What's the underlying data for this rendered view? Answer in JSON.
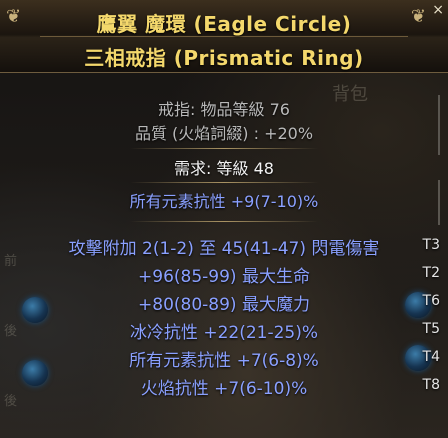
{
  "item": {
    "name_line1": "鷹翼 魔環 (Eagle Circle)",
    "name_line2": "三相戒指 (Prismatic Ring)",
    "category_label": "戒指: 物品等級 76",
    "quality_label": "品質 (火焰詞綴) : +20%",
    "requirements_label": "需求: 等級 48",
    "implicit_mod": "所有元素抗性 +9(7-10)%",
    "explicit_mods": [
      {
        "text": "攻擊附加 2(1-2) 至 45(41-47) 閃電傷害",
        "tier": "T3"
      },
      {
        "text": "+96(85-99) 最大生命",
        "tier": "T2"
      },
      {
        "text": "+80(80-89) 最大魔力",
        "tier": "T6"
      },
      {
        "text": "冰冷抗性 +22(21-25)%",
        "tier": "T5"
      },
      {
        "text": "所有元素抗性 +7(6-8)%",
        "tier": "T4"
      },
      {
        "text": "火焰抗性 +7(6-10)%",
        "tier": "T8"
      }
    ]
  },
  "background": {
    "inventory_label": "背包",
    "left_labels": [
      "前",
      "後",
      "後"
    ]
  },
  "colors": {
    "title_gold": "#f4d86c",
    "mod_blue": "#8aa0ff",
    "text_white": "#f3f3f3"
  },
  "icons": {
    "close": "×",
    "left_ornament": "❦",
    "right_ornament": "❦"
  }
}
